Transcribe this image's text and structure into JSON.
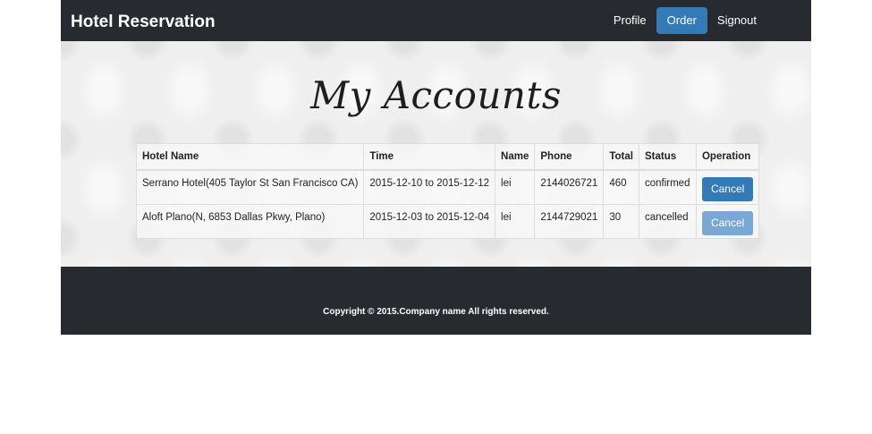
{
  "navbar": {
    "brand": "Hotel Reservation",
    "items": [
      {
        "label": "Profile"
      },
      {
        "label": "Order"
      },
      {
        "label": "Signout"
      }
    ],
    "active": "Order"
  },
  "main": {
    "title": "My Accounts",
    "table": {
      "headers": [
        "Hotel Name",
        "Time",
        "Name",
        "Phone",
        "Total",
        "Status",
        "Operation"
      ],
      "rows": [
        {
          "hotel": "Serrano Hotel(405 Taylor St San Francisco CA)",
          "time": "2015-12-10 to 2015-12-12",
          "name": "lei",
          "phone": "2144026721",
          "total": "460",
          "status": "confirmed",
          "operation": "Cancel",
          "operation_enabled": true
        },
        {
          "hotel": "Aloft Plano(N, 6853 Dallas Pkwy, Plano)",
          "time": "2015-12-03 to 2015-12-04",
          "name": "lei",
          "phone": "2144729021",
          "total": "30",
          "status": "cancelled",
          "operation": "Cancel",
          "operation_enabled": false
        }
      ]
    }
  },
  "footer": {
    "copyright": "Copyright © 2015.Company name All rights reserved."
  },
  "colors": {
    "navbar_bg": "#272b30",
    "accent": "#337ab7",
    "accent_disabled": "#7ba8d2"
  }
}
